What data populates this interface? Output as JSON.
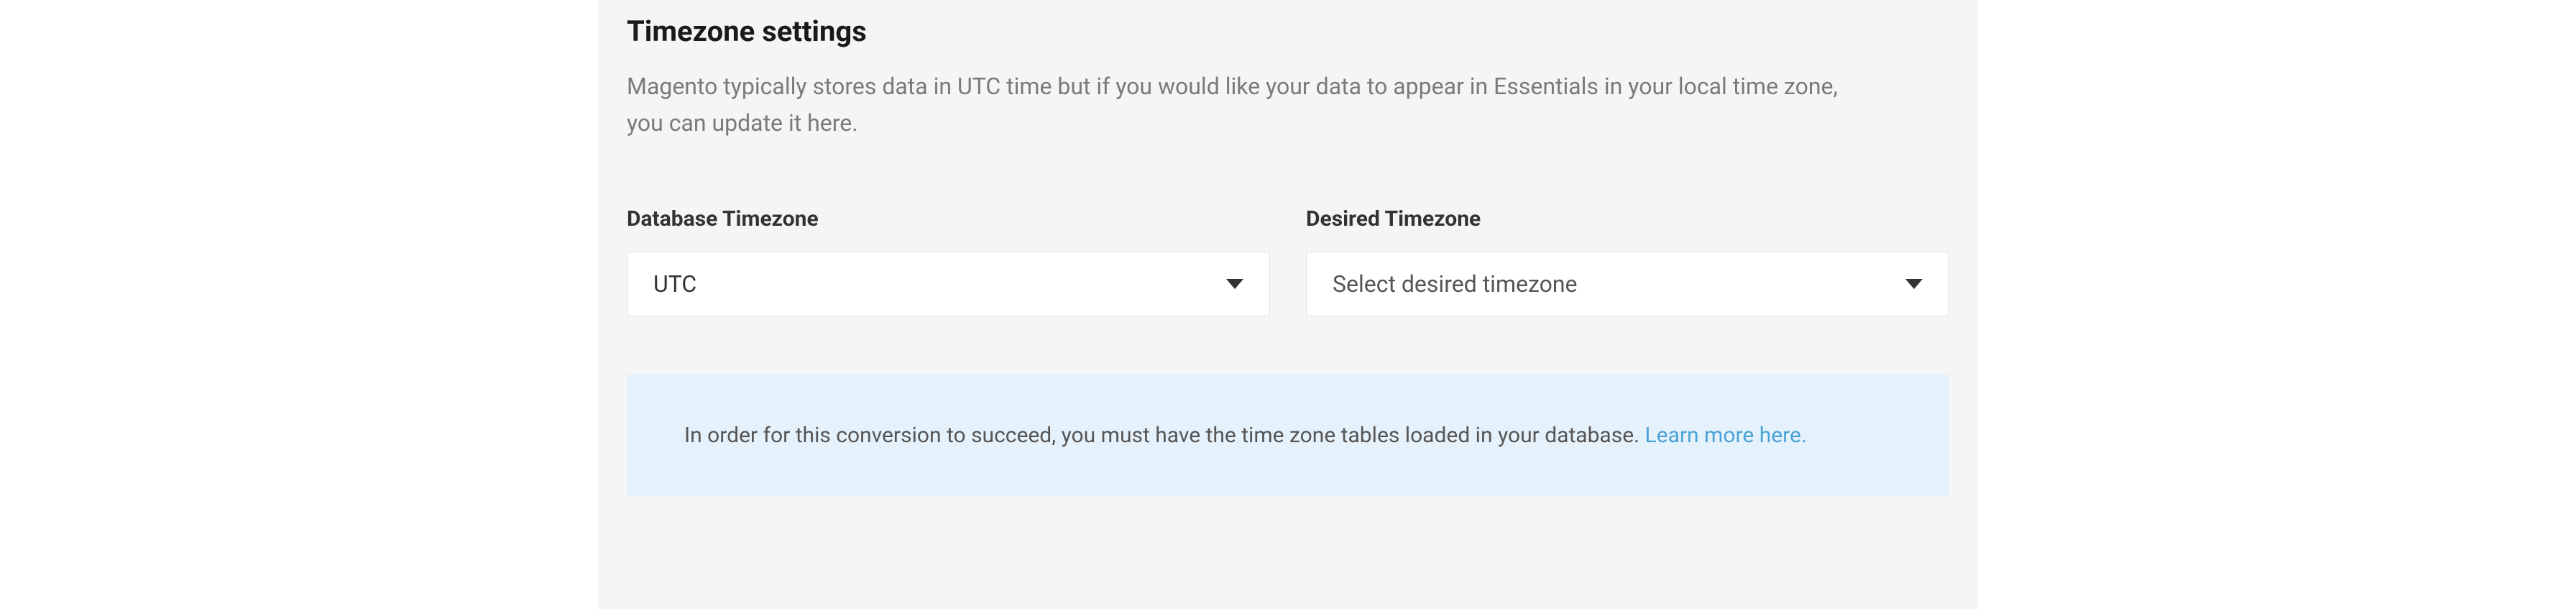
{
  "section": {
    "title": "Timezone settings",
    "description": "Magento typically stores data in UTC time but if you would like your data to appear in Essentials in your local time zone, you can update it here."
  },
  "fields": {
    "database": {
      "label": "Database Timezone",
      "value": "UTC"
    },
    "desired": {
      "label": "Desired Timezone",
      "placeholder": "Select desired timezone"
    }
  },
  "banner": {
    "text": "In order for this conversion to succeed, you must have the time zone tables loaded in your database. ",
    "link_text": "Learn more here."
  }
}
